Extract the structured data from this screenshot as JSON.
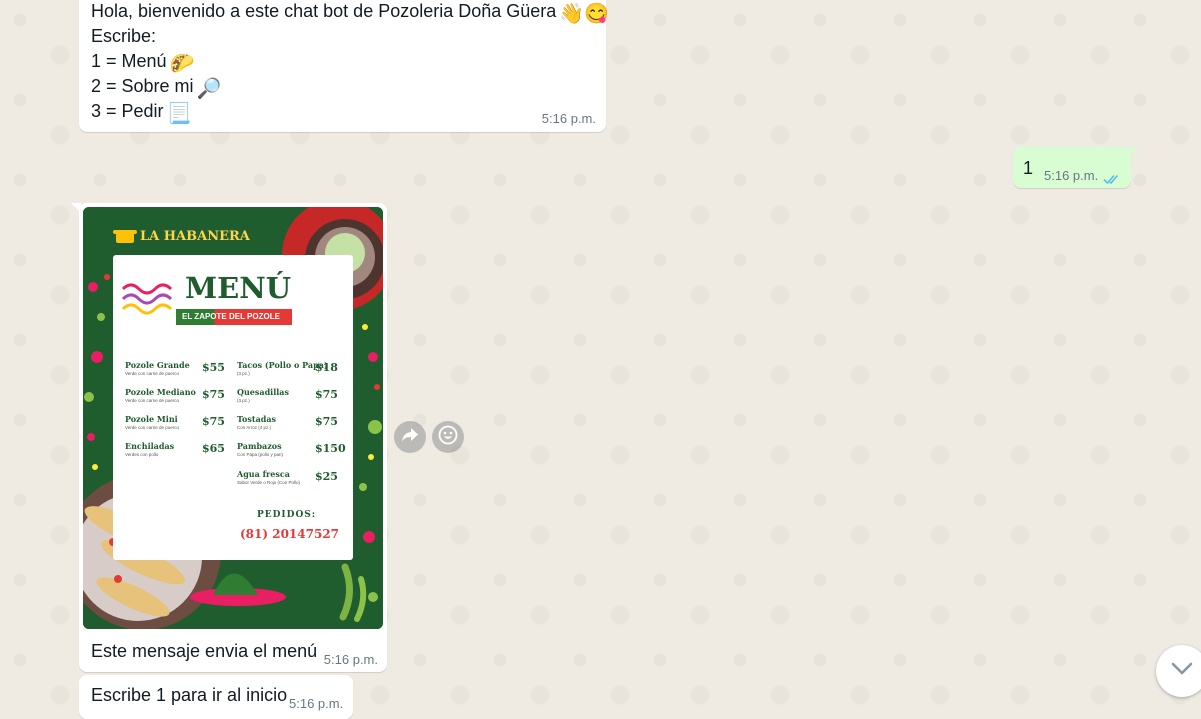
{
  "colors": {
    "chat_bg": "#efeae2",
    "incoming_bubble": "#ffffff",
    "outgoing_bubble": "#d9fdd3",
    "read_ticks": "#53bdeb",
    "timestamp": "#667781",
    "poster_green": "#1f5c2e",
    "poster_red": "#e53935"
  },
  "messages": {
    "welcome": {
      "lines": [
        "Hola, bienvenido a este chat bot de Pozoleria Doña Güera",
        "Escribe:",
        "1 = Menú",
        "2 = Sobre mi",
        "3 = Pedir"
      ],
      "emojis": [
        "👋",
        "😋",
        "🌮",
        "🔎",
        "📃"
      ],
      "time": "5:16 p.m."
    },
    "reply": {
      "text": "1",
      "time": "5:16 p.m.",
      "status_icon": "double-check-icon"
    },
    "menu_image": {
      "caption": "Este mensaje envia el menú",
      "time": "5:16 p.m.",
      "poster": {
        "brand": "LA HABANERA",
        "title": "MENÚ",
        "subtitle": "EL ZAPOTE DEL POZOLE",
        "items": [
          {
            "name": "Pozole Grande",
            "desc": "Verde con carne de puerco",
            "price": "$55"
          },
          {
            "name": "Pozole Mediano",
            "desc": "Verde con carne de puerco",
            "price": "$75"
          },
          {
            "name": "Pozole Mini",
            "desc": "Verde con carne de puerco",
            "price": "$75"
          },
          {
            "name": "Enchiladas",
            "desc": "Verdes con pollo",
            "price": "$65"
          },
          {
            "name": "Tacos (Pollo o Papa)",
            "desc": "(3 pz.)",
            "price": "$18"
          },
          {
            "name": "Quesadillas",
            "desc": "(3 pz.)",
            "price": "$75"
          },
          {
            "name": "Tostadas",
            "desc": "Con Arroz (4 pz.)",
            "price": "$75"
          },
          {
            "name": "Pambazos",
            "desc": "Con Papa (pollo y pan)",
            "price": "$150"
          },
          {
            "name": "Agua fresca",
            "desc": "Sabor Verde o Rojo (Con Pollo)",
            "price": "$25"
          }
        ],
        "orders_label": "PEDIDOS:",
        "phone": "(81) 20147527"
      }
    },
    "restart": {
      "text": "Escribe 1 para ir al inicio",
      "time": "5:16 p.m."
    }
  },
  "actions": {
    "forward_icon": "forward-icon",
    "react_icon": "emoji-icon",
    "scroll_icon": "chevron-down-icon"
  }
}
